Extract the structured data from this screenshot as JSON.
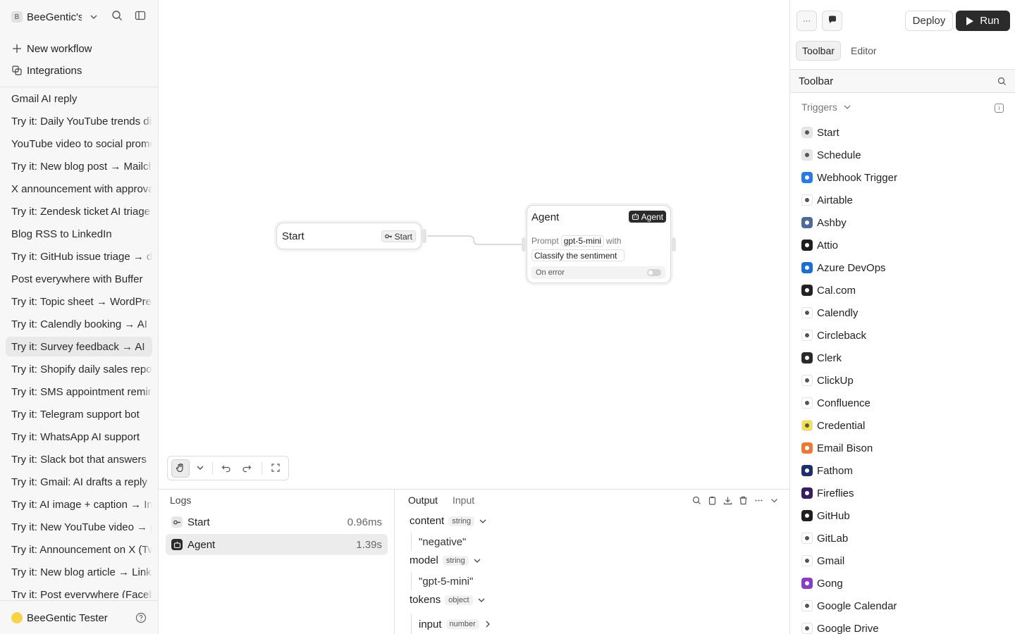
{
  "sidebar": {
    "workspace_initial": "B",
    "workspace_name": "BeeGentic's",
    "actions": [
      {
        "label": "New workflow",
        "icon": "plus-icon"
      },
      {
        "label": "Integrations",
        "icon": "integrations-icon"
      }
    ],
    "workflows": [
      {
        "label": "Gmail AI reply"
      },
      {
        "label": "Try it: Daily YouTube trends digest"
      },
      {
        "label": "YouTube video to social promo"
      },
      {
        "label": "Try it: New blog post → Mailchimp"
      },
      {
        "label": "X announcement with approval"
      },
      {
        "label": "Try it: Zendesk ticket AI triage"
      },
      {
        "label": "Blog RSS to LinkedIn"
      },
      {
        "label": "Try it: GitHub issue triage → digest"
      },
      {
        "label": "Post everywhere with Buffer"
      },
      {
        "label": "Try it: Topic sheet → WordPress"
      },
      {
        "label": "Try it: Calendly booking → AI"
      },
      {
        "label": "Try it: Survey feedback → AI",
        "active": true
      },
      {
        "label": "Try it: Shopify daily sales report"
      },
      {
        "label": "Try it: SMS appointment reminder"
      },
      {
        "label": "Try it: Telegram support bot"
      },
      {
        "label": "Try it: WhatsApp AI support"
      },
      {
        "label": "Try it: Slack bot that answers"
      },
      {
        "label": "Try it: Gmail: AI drafts a reply"
      },
      {
        "label": "Try it: AI image + caption → Instagram"
      },
      {
        "label": "Try it: New YouTube video → post"
      },
      {
        "label": "Try it: Announcement on X (Twitter)"
      },
      {
        "label": "Try it: New blog article → LinkedIn"
      },
      {
        "label": "Try it: Post everywhere (Facebook)"
      }
    ],
    "user_name": "BeeGentic Tester"
  },
  "canvas": {
    "start_node": {
      "title": "Start",
      "chip": "Start"
    },
    "agent_node": {
      "title": "Agent",
      "chip": "Agent",
      "prompt_label": "Prompt",
      "model": "gpt-5-mini",
      "with_label": "with",
      "prompt_text": "Classify the sentiment",
      "on_error": "On error"
    }
  },
  "logs": {
    "title": "Logs",
    "rows": [
      {
        "label": "Start",
        "time": "0.96ms"
      },
      {
        "label": "Agent",
        "time": "1.39s"
      }
    ]
  },
  "output": {
    "tabs": [
      "Output",
      "Input"
    ],
    "fields": [
      {
        "key": "content",
        "type": "string",
        "value": "\"negative\""
      },
      {
        "key": "model",
        "type": "string",
        "value": "\"gpt-5-mini\""
      },
      {
        "key": "tokens",
        "type": "object"
      },
      {
        "key": "input",
        "type": "number"
      }
    ]
  },
  "right_panel": {
    "more_label": "···",
    "deploy_label": "Deploy",
    "run_label": "Run",
    "tabs": [
      "Toolbar",
      "Editor"
    ],
    "header_title": "Toolbar",
    "section_label": "Triggers",
    "triggers": [
      {
        "label": "Start",
        "icon": "start-key-icon",
        "color": "#e6e6e6"
      },
      {
        "label": "Schedule",
        "icon": "clock-icon",
        "color": "#e6e6e6"
      },
      {
        "label": "Webhook Trigger",
        "icon": "webhook-icon",
        "color": "#2b7be5"
      },
      {
        "label": "Airtable",
        "icon": "airtable-icon",
        "color": "#ffffff"
      },
      {
        "label": "Ashby",
        "icon": "ashby-icon",
        "color": "#4d6a99"
      },
      {
        "label": "Attio",
        "icon": "attio-icon",
        "color": "#1f1f1f"
      },
      {
        "label": "Azure DevOps",
        "icon": "azure-devops-icon",
        "color": "#1b6fd0"
      },
      {
        "label": "Cal.com",
        "icon": "cal-com-icon",
        "color": "#222222"
      },
      {
        "label": "Calendly",
        "icon": "calendly-icon",
        "color": "#ffffff"
      },
      {
        "label": "Circleback",
        "icon": "circleback-icon",
        "color": "#ffffff"
      },
      {
        "label": "Clerk",
        "icon": "clerk-icon",
        "color": "#2a2a2a"
      },
      {
        "label": "ClickUp",
        "icon": "clickup-icon",
        "color": "#ffffff"
      },
      {
        "label": "Confluence",
        "icon": "confluence-icon",
        "color": "#ffffff"
      },
      {
        "label": "Credential",
        "icon": "credential-icon",
        "color": "#f4e04d"
      },
      {
        "label": "Email Bison",
        "icon": "email-bison-icon",
        "color": "#e97a3a"
      },
      {
        "label": "Fathom",
        "icon": "fathom-icon",
        "color": "#1d2f6b"
      },
      {
        "label": "Fireflies",
        "icon": "fireflies-icon",
        "color": "#3a1d5e"
      },
      {
        "label": "GitHub",
        "icon": "github-icon",
        "color": "#1f1f1f"
      },
      {
        "label": "GitLab",
        "icon": "gitlab-icon",
        "color": "#ffffff"
      },
      {
        "label": "Gmail",
        "icon": "gmail-icon",
        "color": "#ffffff"
      },
      {
        "label": "Gong",
        "icon": "gong-icon",
        "color": "#8a3ec7"
      },
      {
        "label": "Google Calendar",
        "icon": "google-calendar-icon",
        "color": "#ffffff"
      },
      {
        "label": "Google Drive",
        "icon": "google-drive-icon",
        "color": "#ffffff"
      }
    ]
  }
}
